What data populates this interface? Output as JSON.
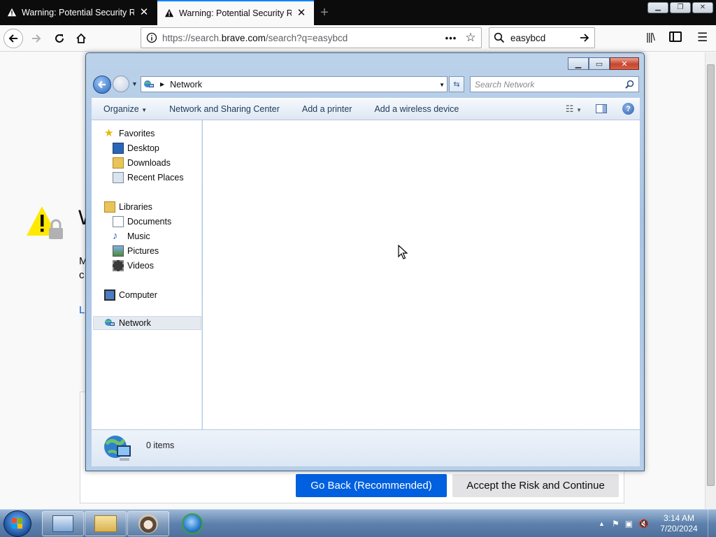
{
  "browser": {
    "tabs": [
      {
        "title": "Warning: Potential Security Risk",
        "active": false
      },
      {
        "title": "Warning: Potential Security Risk",
        "active": true
      }
    ],
    "url_prefix": "https://search.",
    "url_domain": "brave.com",
    "url_suffix": "/search?q=easybcd",
    "search_value": "easybcd"
  },
  "page": {
    "fragments": [
      "W",
      "M",
      "c",
      "L"
    ],
    "buttons": {
      "go_back": "Go Back (Recommended)",
      "accept": "Accept the Risk and Continue"
    }
  },
  "explorer": {
    "address_label": "Network",
    "search_placeholder": "Search Network",
    "commands": [
      "Organize",
      "Network and Sharing Center",
      "Add a printer",
      "Add a wireless device"
    ],
    "nav": {
      "favorites": "Favorites",
      "favorites_items": [
        "Desktop",
        "Downloads",
        "Recent Places"
      ],
      "libraries": "Libraries",
      "libraries_items": [
        "Documents",
        "Music",
        "Pictures",
        "Videos"
      ],
      "computer": "Computer",
      "network": "Network"
    },
    "status": "0 items"
  },
  "taskbar": {
    "time": "3:14 AM",
    "date": "7/20/2024"
  },
  "colors": {
    "primary_button": "#0060df",
    "accent": "#0a84ff"
  }
}
